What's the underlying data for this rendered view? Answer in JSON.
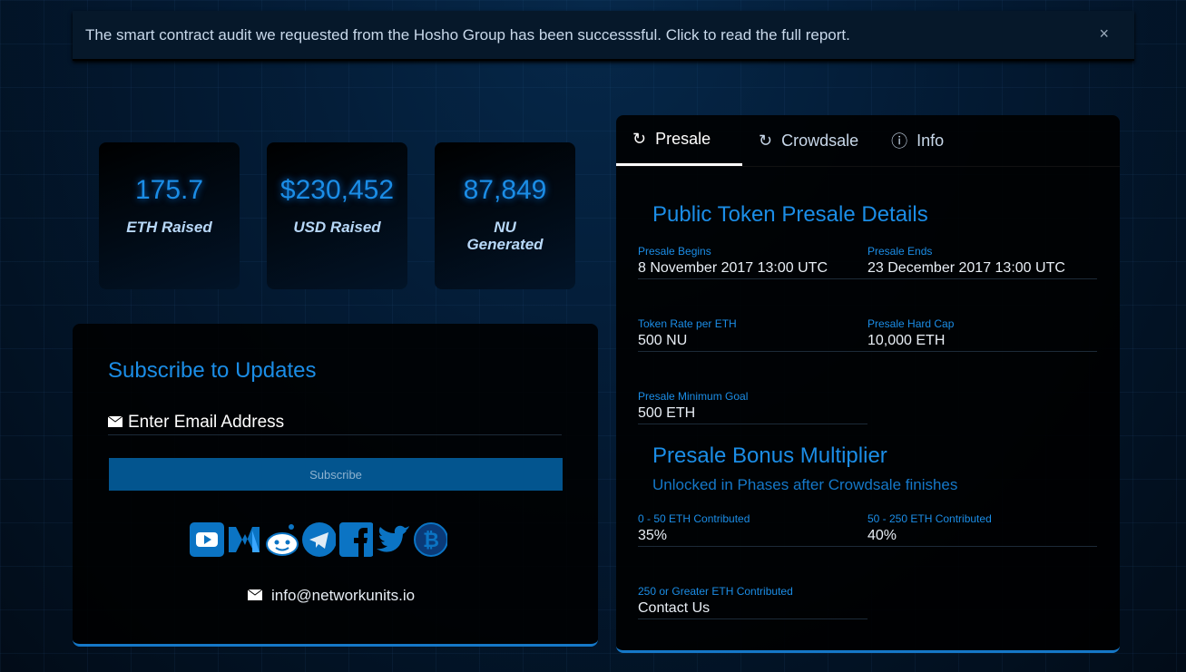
{
  "alert": {
    "text": "The smart contract audit we requested from the Hosho Group has been successsful. Click to read the full report.",
    "close": "×"
  },
  "stats": [
    {
      "value": "175.7",
      "label": "ETH Raised"
    },
    {
      "value": "$230,452",
      "label": "USD Raised"
    },
    {
      "value": "87,849",
      "label": "NU Generated"
    }
  ],
  "subscribe": {
    "title": "Subscribe to Updates",
    "email_placeholder": "Enter Email Address",
    "button": "Subscribe",
    "contact_email": "info@networkunits.io"
  },
  "tabs": [
    {
      "label": "Presale"
    },
    {
      "label": "Crowdsale"
    },
    {
      "label": "Info"
    }
  ],
  "presale": {
    "title": "Public Token Presale Details",
    "fields": [
      {
        "k": "Presale Begins",
        "v": "8 November 2017 13:00 UTC"
      },
      {
        "k": "Presale Ends",
        "v": "23 December 2017 13:00 UTC"
      },
      {
        "k": "Token Rate per ETH",
        "v": "500 NU"
      },
      {
        "k": "Presale Hard Cap",
        "v": "10,000 ETH"
      },
      {
        "k": "Presale Minimum Goal",
        "v": "500 ETH"
      }
    ],
    "bonus_title": "Presale Bonus Multiplier",
    "bonus_subtitle": "Unlocked in Phases after Crowdsale finishes",
    "bonus": [
      {
        "k": "0 - 50 ETH Contributed",
        "v": "35%"
      },
      {
        "k": "50 - 250 ETH Contributed",
        "v": "40%"
      },
      {
        "k": "250 or Greater ETH Contributed",
        "v": "Contact Us"
      }
    ]
  }
}
